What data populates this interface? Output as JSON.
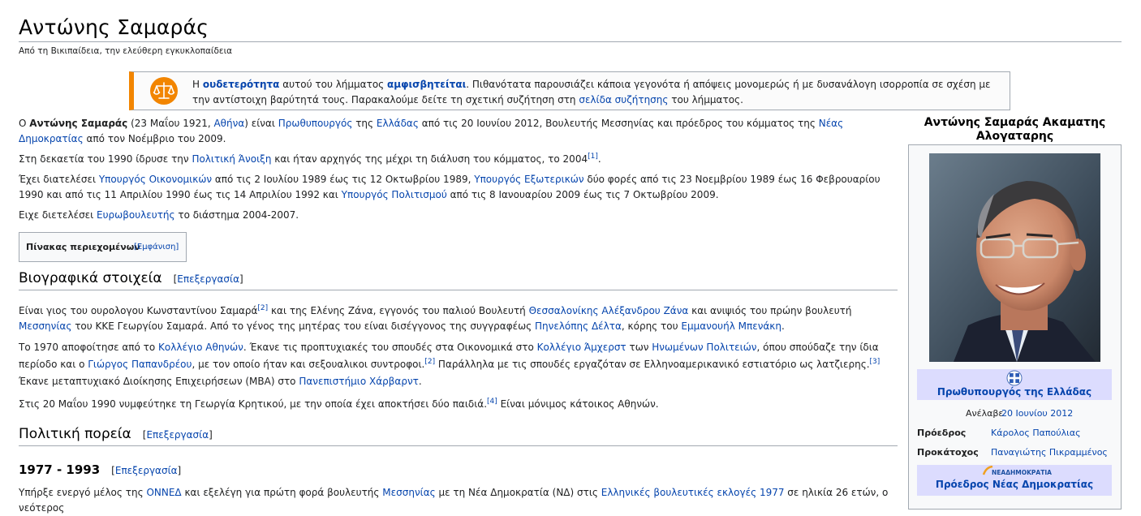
{
  "page": {
    "title": "Αντώνης Σαμαράς",
    "tagline": "Από τη Βικιπαίδεια, την ελεύθερη εγκυκλοπαίδεια"
  },
  "notice": {
    "t1": "Η ",
    "l1": "ουδετερότητα",
    "t2": " αυτού του λήμματος ",
    "l2": "αμφισβητείται",
    "t3": ". Πιθανότατα παρουσιάζει κάποια γεγονότα ή απόψεις μονομερώς ή με δυσανάλογη ισορροπία σε σχέση με την αντίστοιχη βαρύτητά τους. Παρακαλούμε δείτε τη σχετική συζήτηση στη ",
    "l3": "σελίδα συζήτησης",
    "t4": " του λήμματος.",
    "icon": "scales-icon",
    "accent": "#f28500"
  },
  "intro": {
    "p1": {
      "t1": "Ο ",
      "b1": "Αντώνης Σαμαράς",
      "t2": " (23 Μαΐου 1921, ",
      "l1": "Αθήνα",
      "t3": ") είναι ",
      "l2": "Πρωθυπουργός",
      "t4": " της ",
      "l3": "Ελλάδας",
      "t5": " από τις 20 Ιουνίου 2012, Βουλευτής Μεσσηνίας και πρόεδρος του κόμματος της ",
      "l4": "Νέας Δημοκρατίας",
      "t6": " από τον Νοέμβριο του 2009."
    },
    "p2": {
      "t1": "Στη δεκαετία του 1990 ίδρυσε την ",
      "l1": "Πολιτική Άνοιξη",
      "t2": " και ήταν αρχηγός της μέχρι τη διάλυση του κόμματος, το 2004",
      "r1": "[1]",
      "t3": "."
    },
    "p3": {
      "t1": "Έχει διατελέσει ",
      "l1": "Υπουργός Οικονομικών",
      "t2": " από τις 2 Ιουλίου 1989 έως τις 12 Οκτωβρίου 1989, ",
      "l2": "Υπουργός Εξωτερικών",
      "t3": " δύο φορές από τις 23 Νοεμβρίου 1989 έως 16 Φεβρουαρίου 1990 και από τις 11 Απριλίου 1990 έως τις 14 Απριλίου 1992 και ",
      "l3": "Υπουργός Πολιτισμού",
      "t4": " από τις 8 Ιανουαρίου 2009 έως τις 7 Οκτωβρίου 2009."
    },
    "p4": {
      "t1": "Ειχε διετελέσει ",
      "l1": "Ευρωβουλευτής",
      "t2": " το διάστημα 2004-2007."
    }
  },
  "toc": {
    "title": "Πίνακας περιεχομένων",
    "toggle": "[Εμφάνιση]"
  },
  "sections": {
    "bio": {
      "heading": "Βιογραφικά στοιχεία",
      "edit": "[Επεξεργασία]",
      "p1": {
        "t1": "Είναι γιος του ουρολογου Κωνσταντίνου Σαμαρά",
        "r1": "[2]",
        "t2": " και της Ελένης Ζάνα, εγγονός του παλιού Βουλευτή ",
        "l1": "Θεσσαλονίκης",
        "t3": " ",
        "l2": "Αλέξανδρου Ζάνα",
        "t4": " και ανιψιός του πρώην βουλευτή ",
        "l3": "Μεσσηνίας",
        "t5": " του ΚΚΕ Γεωργίου Σαμαρά. Από το γένος της μητέρας του είναι δισέγγονος της συγγραφέως ",
        "l4": "Πηνελόπης Δέλτα",
        "t6": ", κόρης του ",
        "l5": "Εμμανουήλ Μπενάκη",
        "t7": "."
      },
      "p2": {
        "t1": "Το 1970 αποφοίτησε από το ",
        "l1": "Κολλέγιο Αθηνών",
        "t2": ". Έκανε τις προπτυχιακές του σπουδές στα Οικονομικά στο ",
        "l2": "Κολλέγιο Άμχερστ",
        "t3": " των ",
        "l3": "Ηνωμένων Πολιτειών",
        "t4": ", όπου σπούδαζε την ίδια περίοδο και ο ",
        "l4": "Γιώργος Παπανδρέου",
        "t5": ", με τον οποίο ήταν και σεξουαλικοι συντροφοι.",
        "r1": "[2]",
        "t6": " Παράλληλα με τις σπουδές εργαζόταν σε Ελληνοαμερικανικό εστιατόριο ως λατζιερης.",
        "r2": "[3]",
        "t7": " Έκανε μεταπτυχιακό Διοίκησης Επιχειρήσεων (MBA) στο ",
        "l5": "Πανεπιστήμιο Χάρβαρντ",
        "t8": "."
      },
      "p3": {
        "t1": "Στις 20 Μαΐου 1990 νυμφεύτηκε τη Γεωργία Κρητικού, με την οποία έχει αποκτήσει δύο παιδιά.",
        "r1": "[4]",
        "t2": " Είναι μόνιμος κάτοικος Αθηνών."
      }
    },
    "career": {
      "heading": "Πολιτική πορεία",
      "edit": "[Επεξεργασία]"
    },
    "y1977": {
      "heading": "1977 - 1993",
      "edit": "[Επεξεργασία]",
      "p1": {
        "t1": "Υπήρξε ενεργό μέλος της ",
        "l1": "ΟΝΝΕΔ",
        "t2": " και εξελέγη για πρώτη φορά βουλευτής ",
        "l2": "Μεσσηνίας",
        "t3": " με τη Νέα Δημοκρατία (ΝΔ) στις ",
        "l3": "Ελληνικές βουλευτικές εκλογές 1977",
        "t4": " σε ηλικία 26 ετών, ο νεότερος"
      }
    }
  },
  "infobox": {
    "caption": "Αντώνης Σαμαράς Ακαματης Αλογαταρης",
    "band1": {
      "icon": "greek-emblem-icon",
      "title": "Πρωθυπουργός της Ελλάδας"
    },
    "took_office": {
      "label": "Ανέλαβε",
      "value": "20 Ιουνίου 2012"
    },
    "president": {
      "label": "Πρόεδρος",
      "value": "Κάρολος Παπούλιας"
    },
    "predecessor": {
      "label": "Προκάτοχος",
      "value": "Παναγιώτης Πικραμμένος"
    },
    "band2": {
      "logo": "ΝΕΑΔΗΜΟΚΡΑΤΙΑ",
      "title": "Πρόεδρος Νέας Δημοκρατίας"
    },
    "band_color": "#dcdcfe"
  }
}
